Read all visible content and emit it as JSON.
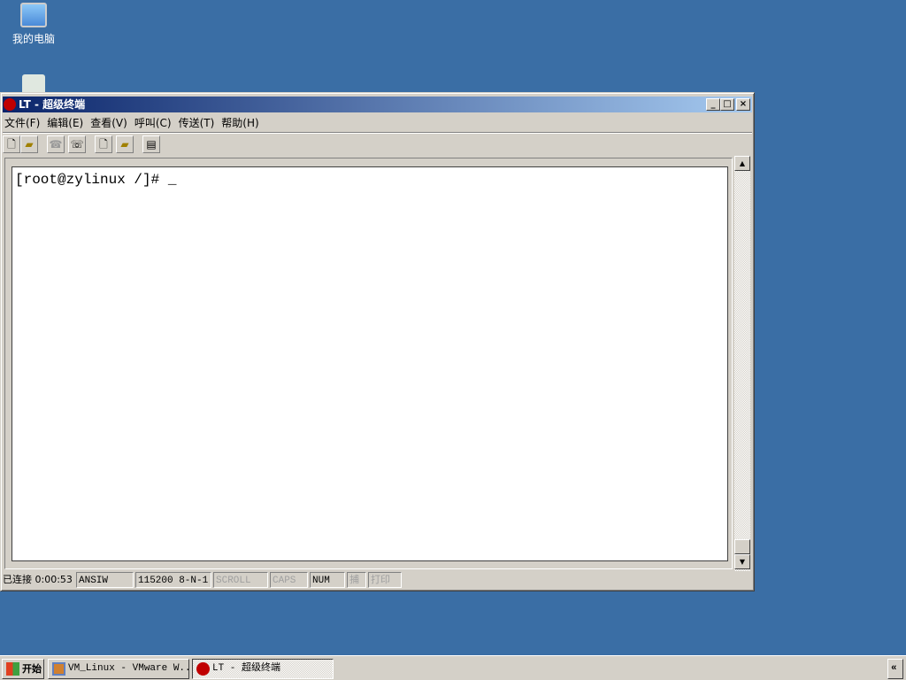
{
  "desktop": {
    "icons": [
      {
        "label": "我的电脑",
        "icon": "my-computer-icon"
      },
      {
        "label": "",
        "icon": "recycle-bin-icon"
      }
    ]
  },
  "window": {
    "title": "LT - 超级终端",
    "minimize": "_",
    "maximize": "□",
    "close": "×",
    "menu": [
      "文件(F)",
      "编辑(E)",
      "查看(V)",
      "呼叫(C)",
      "传送(T)",
      "帮助(H)"
    ],
    "toolbar": [
      "new",
      "open",
      "disconnect",
      "call",
      "send",
      "receive",
      "properties"
    ],
    "terminal_text": "[root@zylinux /]# _",
    "status": {
      "connected": "已连接 0:00:53",
      "emulation": "ANSIW",
      "port": "115200 8-N-1",
      "scroll": "SCROLL",
      "caps": "CAPS",
      "num": "NUM",
      "capture": "捕",
      "print": "打印"
    }
  },
  "taskbar": {
    "start": "开始",
    "tasks": [
      "VM_Linux - VMware W...",
      "LT - 超级终端"
    ],
    "tray": "«"
  }
}
